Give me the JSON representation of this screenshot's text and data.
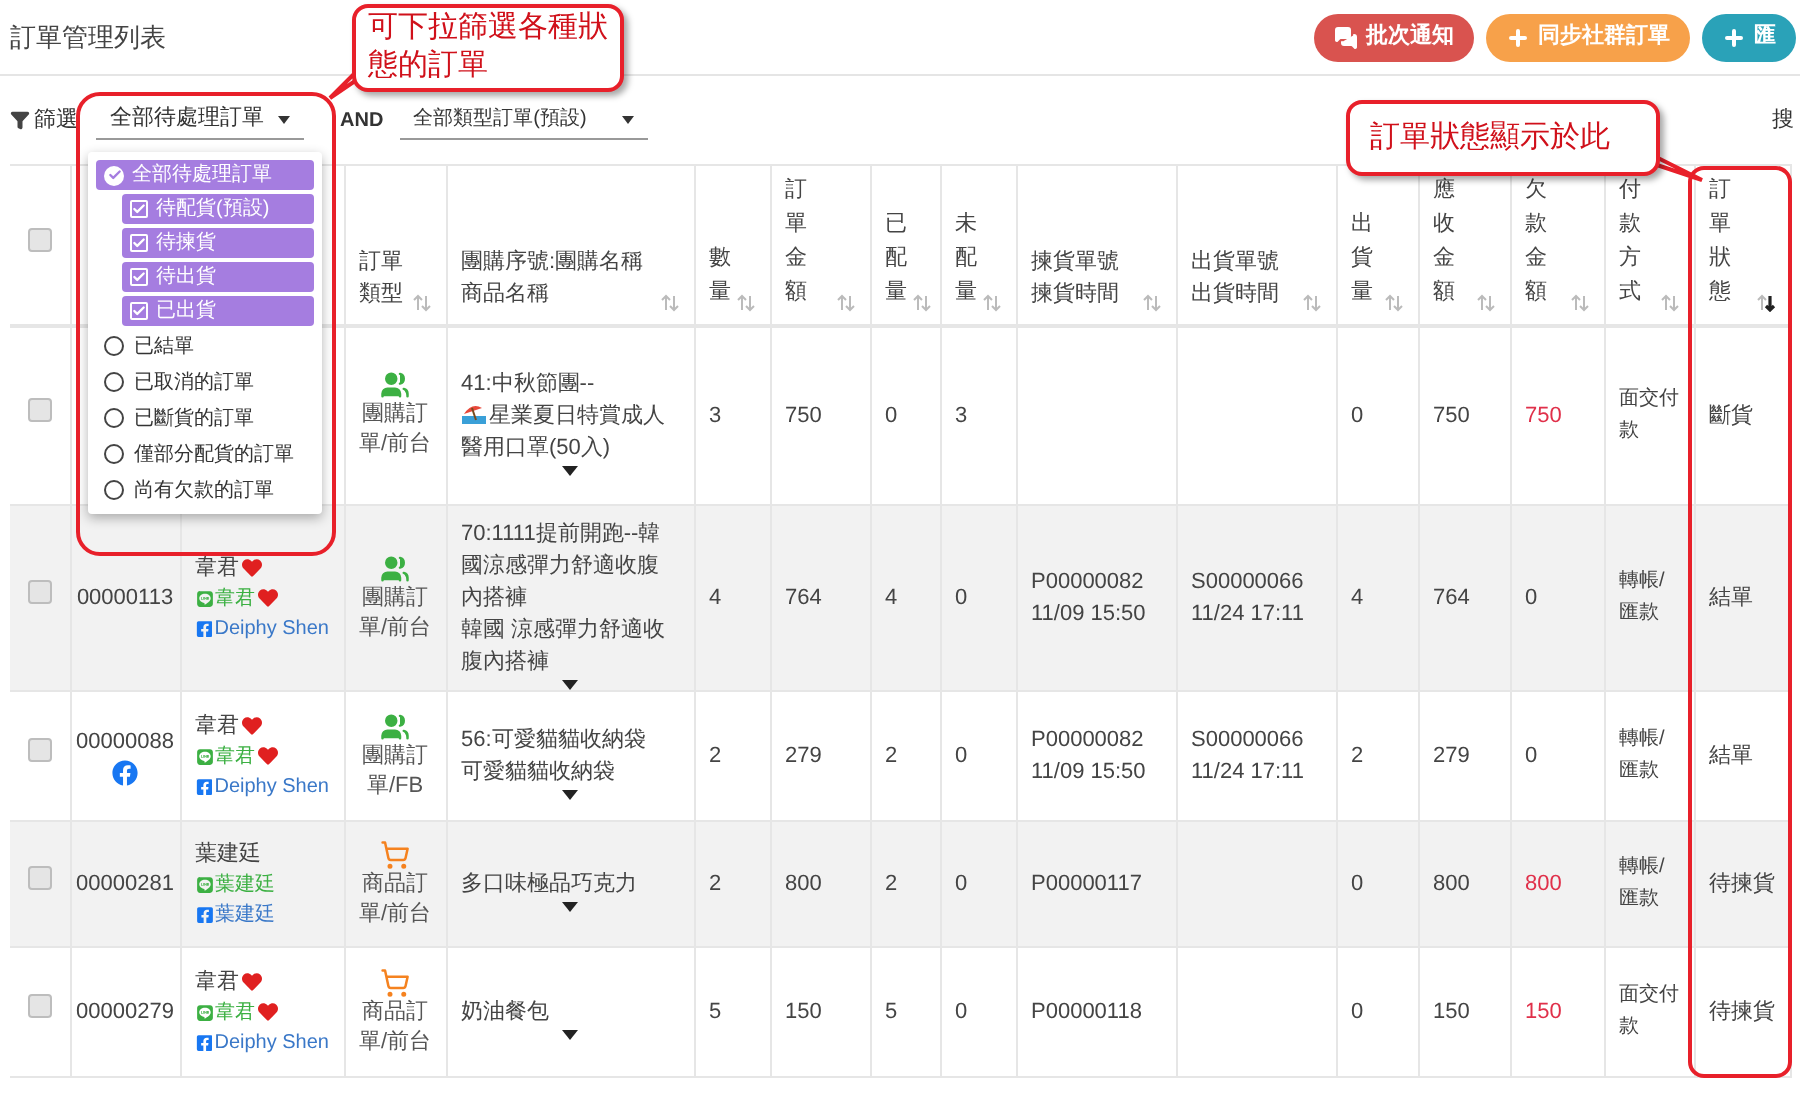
{
  "page_title": "訂單管理列表",
  "actions": [
    {
      "label": "批次通知",
      "kind": "notify"
    },
    {
      "label": "同步社群訂單",
      "kind": "sync"
    },
    {
      "label": "匯",
      "kind": "add"
    }
  ],
  "search_label": "搜",
  "filter": {
    "label": "篩選",
    "status_select": "全部待處理訂單",
    "joiner": "AND",
    "type_select": "全部類型訂單(預設)"
  },
  "status_menu": {
    "options": [
      {
        "label": "全部待處理訂單",
        "kind": "group",
        "checked": true,
        "children": [
          {
            "label": "待配貨(預設)",
            "checked": true
          },
          {
            "label": "待揀貨",
            "checked": true
          },
          {
            "label": "待出貨",
            "checked": true
          },
          {
            "label": "已出貨",
            "checked": true
          }
        ]
      },
      {
        "label": "已結單",
        "kind": "radio",
        "checked": false
      },
      {
        "label": "已取消的訂單",
        "kind": "radio",
        "checked": false
      },
      {
        "label": "已斷貨的訂單",
        "kind": "radio",
        "checked": false
      },
      {
        "label": "僅部分配貨的訂單",
        "kind": "radio",
        "checked": false
      },
      {
        "label": "尚有欠款的訂單",
        "kind": "radio",
        "checked": false
      }
    ]
  },
  "table": {
    "select_all": {
      "checked": false
    },
    "columns": [
      {
        "label": "訂單類型",
        "kind": "wrap",
        "sorted": false
      },
      {
        "label": "團購序號:團購名稱",
        "label2": "商品名稱",
        "kind": "lines",
        "sorted": false
      },
      {
        "label": "數量",
        "kind": "stacked",
        "sorted": false
      },
      {
        "label": "訂單金額",
        "kind": "stacked",
        "sorted": false
      },
      {
        "label": "已配量",
        "kind": "stacked",
        "sorted": false
      },
      {
        "label": "未配量",
        "kind": "stacked",
        "sorted": false
      },
      {
        "label": "揀貨單號",
        "label2": "揀貨時間",
        "kind": "lines",
        "sorted": false
      },
      {
        "label": "出貨單號",
        "label2": "出貨時間",
        "kind": "lines",
        "sorted": false
      },
      {
        "label": "出貨量",
        "kind": "stacked",
        "sorted": false
      },
      {
        "label": "應收金額",
        "kind": "stacked",
        "sorted": false
      },
      {
        "label": "欠款金額",
        "kind": "stacked",
        "sorted": false
      },
      {
        "label": "付款方式",
        "kind": "stacked",
        "sorted": false
      },
      {
        "label": "訂單狀態",
        "kind": "stacked",
        "sorted": true
      }
    ],
    "rows": [
      {
        "checked": false,
        "type": {
          "kind": "group",
          "label": "團購訂單/前台"
        },
        "product": [
          {
            "text": "41:中秋節團--",
            "icon": false
          },
          {
            "text": "星業夏日特賞成人醫用口罩(50入)",
            "icon": true
          }
        ],
        "qty": "3",
        "amount": "750",
        "allocated": "0",
        "unallocated": "3",
        "shipped": "0",
        "receivable": "750",
        "owed": "750",
        "owed_alert": true,
        "payment": "面交付款",
        "status": "斷貨"
      },
      {
        "checked": false,
        "order_no": "00000113",
        "order_fb": false,
        "customer": {
          "name": "韋君",
          "line_name": "韋君",
          "fb_name": "Deiphy Shen",
          "heart": true
        },
        "type": {
          "kind": "group",
          "label": "團購訂單/前台"
        },
        "product": [
          {
            "text": "70:1111提前開跑--韓國涼感彈力舒適收腹內搭褲",
            "icon": false
          },
          {
            "text": "韓國 涼感彈力舒適收腹內搭褲",
            "icon": false
          }
        ],
        "qty": "4",
        "amount": "764",
        "allocated": "4",
        "unallocated": "0",
        "pick_no": "P00000082",
        "pick_time": "11/09 15:50",
        "ship_no": "S00000066",
        "ship_time": "11/24 17:11",
        "shipped": "4",
        "receivable": "764",
        "owed": "0",
        "owed_alert": false,
        "payment": "轉帳/匯款",
        "status": "結單"
      },
      {
        "checked": false,
        "order_no": "00000088",
        "order_fb": true,
        "customer": {
          "name": "韋君",
          "line_name": "韋君",
          "fb_name": "Deiphy Shen",
          "heart": true
        },
        "type": {
          "kind": "group",
          "label": "團購訂單/FB"
        },
        "product": [
          {
            "text": "56:可愛貓貓收納袋",
            "icon": false
          },
          {
            "text": "可愛貓貓收納袋",
            "icon": false
          }
        ],
        "qty": "2",
        "amount": "279",
        "allocated": "2",
        "unallocated": "0",
        "pick_no": "P00000082",
        "pick_time": "11/09 15:50",
        "ship_no": "S00000066",
        "ship_time": "11/24 17:11",
        "shipped": "2",
        "receivable": "279",
        "owed": "0",
        "owed_alert": false,
        "payment": "轉帳/匯款",
        "status": "結單"
      },
      {
        "checked": false,
        "order_no": "00000281",
        "order_fb": false,
        "customer": {
          "name": "葉建廷",
          "line_name": "葉建廷",
          "fb_name": "葉建廷",
          "heart": false
        },
        "type": {
          "kind": "shop",
          "label": "商品訂單/前台"
        },
        "product": [
          {
            "text": "多口味極品巧克力",
            "icon": false
          }
        ],
        "qty": "2",
        "amount": "800",
        "allocated": "2",
        "unallocated": "0",
        "pick_no": "P00000117",
        "shipped": "0",
        "receivable": "800",
        "owed": "800",
        "owed_alert": true,
        "payment": "轉帳/匯款",
        "status": "待揀貨"
      },
      {
        "checked": false,
        "order_no": "00000279",
        "order_fb": false,
        "customer": {
          "name": "韋君",
          "line_name": "韋君",
          "fb_name": "Deiphy Shen",
          "heart": true
        },
        "type": {
          "kind": "shop",
          "label": "商品訂單/前台"
        },
        "product": [
          {
            "text": "奶油餐包",
            "icon": false
          }
        ],
        "qty": "5",
        "amount": "150",
        "allocated": "5",
        "unallocated": "0",
        "pick_no": "P00000118",
        "shipped": "0",
        "receivable": "150",
        "owed": "150",
        "owed_alert": true,
        "payment": "面交付款",
        "status": "待揀貨"
      }
    ]
  },
  "annotations": [
    {
      "text": "可下拉篩選各種狀態的訂單",
      "kind": "filter"
    },
    {
      "text": "訂單狀態顯示於此",
      "kind": "status"
    }
  ]
}
